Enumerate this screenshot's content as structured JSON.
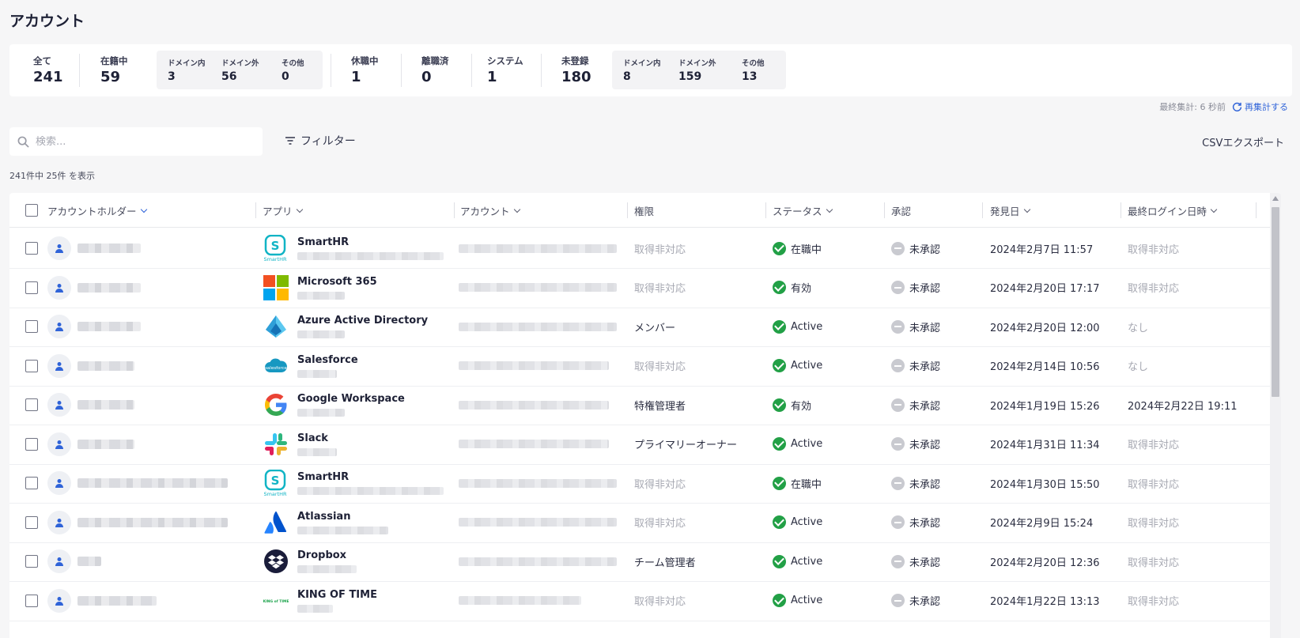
{
  "page": {
    "title": "アカウント"
  },
  "stats": {
    "all": {
      "label": "全て",
      "value": "241"
    },
    "enrolled": {
      "label": "在籍中",
      "value": "59",
      "sub": [
        {
          "label": "ドメイン内",
          "value": "3"
        },
        {
          "label": "ドメイン外",
          "value": "56"
        },
        {
          "label": "その他",
          "value": "0"
        }
      ]
    },
    "leave": {
      "label": "休職中",
      "value": "1"
    },
    "retired": {
      "label": "離職済",
      "value": "0"
    },
    "system": {
      "label": "システム",
      "value": "1"
    },
    "unregistered": {
      "label": "未登録",
      "value": "180",
      "sub": [
        {
          "label": "ドメイン内",
          "value": "8"
        },
        {
          "label": "ドメイン外",
          "value": "159"
        },
        {
          "label": "その他",
          "value": "13"
        }
      ]
    }
  },
  "last_count": {
    "text": "最終集計: 6 秒前",
    "recount_label": "再集計する"
  },
  "toolbar": {
    "search_placeholder": "検索...",
    "filter_label": "フィルター",
    "csv_label": "CSVエクスポート"
  },
  "result_count": "241件中 25件 を表示",
  "table": {
    "columns": {
      "holder": "アカウントホルダー",
      "app": "アプリ",
      "account": "アカウント",
      "role": "権限",
      "status": "ステータス",
      "approval": "承認",
      "found": "発見日",
      "last_login": "最終ログイン日時"
    },
    "rows": [
      {
        "app": "SmartHR",
        "logo": "smarthr-logo",
        "role": "取得非対応",
        "status": "在職中",
        "approval": "未承認",
        "found": "2024年2月7日 11:57",
        "last_login": "取得非対応"
      },
      {
        "app": "Microsoft 365",
        "logo": "microsoft-logo",
        "role": "取得非対応",
        "status": "有効",
        "approval": "未承認",
        "found": "2024年2月20日 17:17",
        "last_login": "取得非対応"
      },
      {
        "app": "Azure Active Directory",
        "logo": "azure-logo",
        "role": "メンバー",
        "status": "Active",
        "approval": "未承認",
        "found": "2024年2月20日 12:00",
        "last_login": "なし"
      },
      {
        "app": "Salesforce",
        "logo": "salesforce-logo",
        "role": "取得非対応",
        "status": "Active",
        "approval": "未承認",
        "found": "2024年2月14日 10:56",
        "last_login": "なし"
      },
      {
        "app": "Google Workspace",
        "logo": "google-logo",
        "role": "特権管理者",
        "status": "有効",
        "approval": "未承認",
        "found": "2024年1月19日 15:26",
        "last_login": "2024年2月22日 19:11"
      },
      {
        "app": "Slack",
        "logo": "slack-logo",
        "role": "プライマリーオーナー",
        "status": "Active",
        "approval": "未承認",
        "found": "2024年1月31日 11:34",
        "last_login": "取得非対応"
      },
      {
        "app": "SmartHR",
        "logo": "smarthr-logo",
        "role": "取得非対応",
        "status": "在職中",
        "approval": "未承認",
        "found": "2024年1月30日 15:50",
        "last_login": "取得非対応"
      },
      {
        "app": "Atlassian",
        "logo": "atlassian-logo",
        "role": "取得非対応",
        "status": "Active",
        "approval": "未承認",
        "found": "2024年2月9日 15:24",
        "last_login": "取得非対応"
      },
      {
        "app": "Dropbox",
        "logo": "dropbox-logo",
        "role": "チーム管理者",
        "status": "Active",
        "approval": "未承認",
        "found": "2024年2月20日 12:36",
        "last_login": "取得非対応"
      },
      {
        "app": "KING OF TIME",
        "logo": "kingoftime-logo",
        "role": "取得非対応",
        "status": "Active",
        "approval": "未承認",
        "found": "2024年1月22日 13:13",
        "last_login": "取得非対応"
      }
    ]
  },
  "colors": {
    "accent": "#2f63d8",
    "success": "#22a046",
    "muted": "#a6a8b2"
  }
}
